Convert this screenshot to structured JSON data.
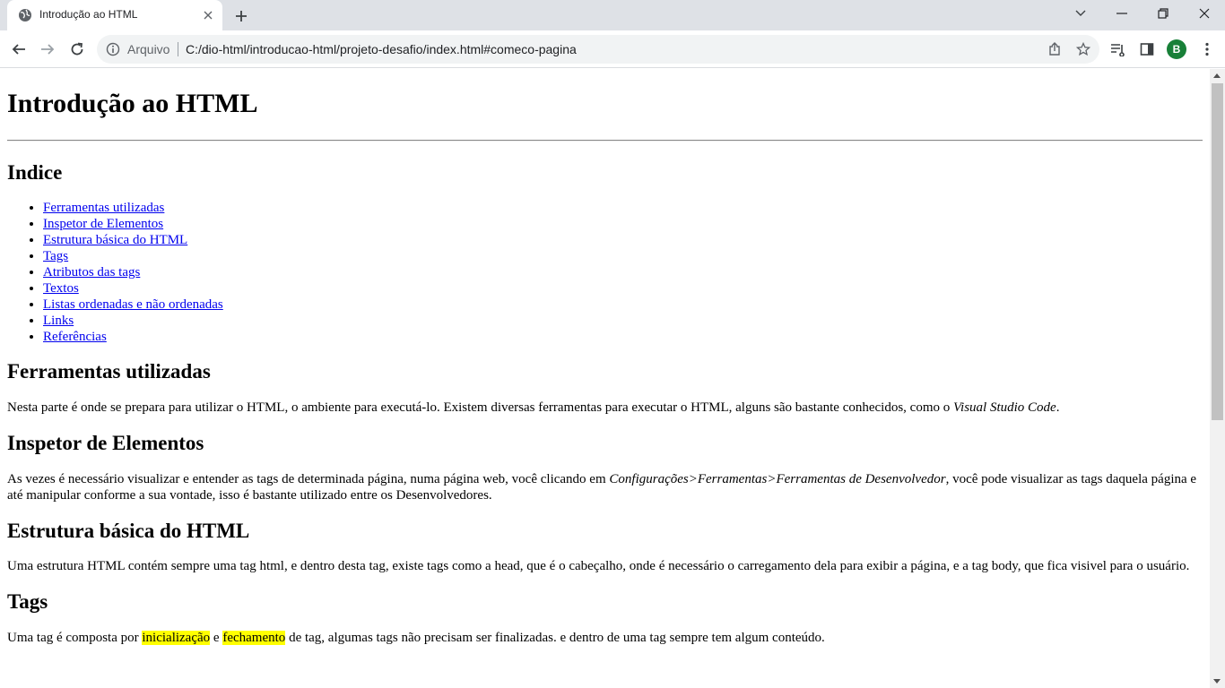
{
  "browser": {
    "tab_title": "Introdução ao HTML",
    "scheme_label": "Arquivo",
    "url": "C:/dio-html/introducao-html/projeto-desafio/index.html#comeco-pagina",
    "profile_initial": "B",
    "profile_color": "#188038",
    "icons": [
      "globe-icon",
      "close-icon",
      "plus-icon",
      "chevron-down-icon",
      "minimize-icon",
      "restore-icon",
      "close-window-icon",
      "back-icon",
      "forward-icon",
      "reload-icon",
      "info-icon",
      "share-icon",
      "star-icon",
      "reading-list-icon",
      "side-panel-icon",
      "kebab-menu-icon"
    ]
  },
  "page": {
    "title": "Introdução ao HTML",
    "index_heading": "Indice",
    "index_items": [
      "Ferramentas utilizadas",
      "Inspetor de Elementos",
      "Estrutura básica do HTML",
      "Tags",
      "Atributos das tags",
      "Textos",
      "Listas ordenadas e não ordenadas",
      "Links",
      "Referências"
    ],
    "section_tools": {
      "heading": "Ferramentas utilizadas",
      "text_before": "Nesta parte é onde se prepara para utilizar o HTML, o ambiente para executá-lo. Existem diversas ferramentas para executar o HTML, alguns são bastante conhecidos, como o ",
      "emphasis": "Visual Studio Code",
      "text_after": "."
    },
    "section_inspector": {
      "heading": "Inspetor de Elementos",
      "text_before": "As vezes é necessário visualizar e entender as tags de determinada página, numa página web, você clicando em ",
      "emphasis": "Configurações>Ferramentas>Ferramentas de Desenvolvedor",
      "text_after": ", você pode visualizar as tags daquela página e até manipular conforme a sua vontade, isso é bastante utilizado entre os Desenvolvedores."
    },
    "section_structure": {
      "heading": "Estrutura básica do HTML",
      "text": "Uma estrutura HTML contém sempre uma tag html, e dentro desta tag, existe tags como a head, que é o cabeçalho, onde é necessário o carregamento dela para exibir a página, e a tag body, que fica visivel para o usuário."
    },
    "section_tags": {
      "heading": "Tags",
      "text_before": "Uma tag é composta por ",
      "mark1": "inicialização",
      "text_mid": " e ",
      "mark2": "fechamento",
      "text_after": " de tag, algumas tags não precisam ser finalizadas. e dentro de uma tag sempre tem algum conteúdo."
    },
    "link_color": "#0000ee",
    "highlight_color": "#ffff00"
  }
}
